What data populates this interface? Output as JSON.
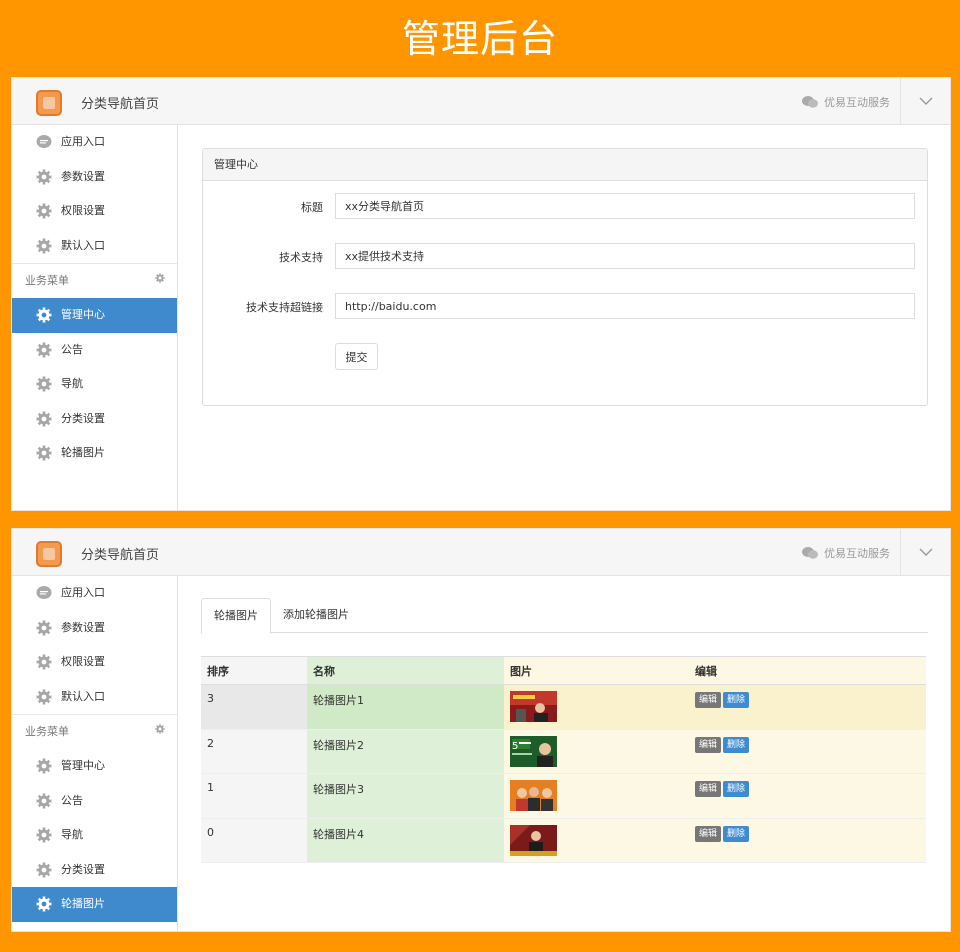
{
  "banner": {
    "title": "管理后台"
  },
  "app": {
    "title": "分类导航首页",
    "service": "优易互动服务"
  },
  "sidebar": {
    "top_items": [
      {
        "label": "应用入口",
        "icon": "chat-icon"
      },
      {
        "label": "参数设置",
        "icon": "gear-icon"
      },
      {
        "label": "权限设置",
        "icon": "gear-icon"
      },
      {
        "label": "默认入口",
        "icon": "gear-icon"
      }
    ],
    "section_label": "业务菜单",
    "biz_items": [
      {
        "label": "管理中心"
      },
      {
        "label": "公告"
      },
      {
        "label": "导航"
      },
      {
        "label": "分类设置"
      },
      {
        "label": "轮播图片"
      }
    ]
  },
  "panel1": {
    "active_item": "管理中心",
    "card_title": "管理中心",
    "fields": [
      {
        "label": "标题",
        "value": "xx分类导航首页"
      },
      {
        "label": "技术支持",
        "value": "xx提供技术支持"
      },
      {
        "label": "技术支持超链接",
        "value": "http://baidu.com"
      }
    ],
    "submit_label": "提交"
  },
  "panel2": {
    "active_item": "轮播图片",
    "tabs": [
      "轮播图片",
      "添加轮播图片"
    ],
    "columns": [
      "排序",
      "名称",
      "图片",
      "编辑"
    ],
    "rows": [
      {
        "order": "3",
        "name": "轮播图片1"
      },
      {
        "order": "2",
        "name": "轮播图片2"
      },
      {
        "order": "1",
        "name": "轮播图片3"
      },
      {
        "order": "0",
        "name": "轮播图片4"
      }
    ],
    "edit_label": "编辑",
    "delete_label": "删除"
  },
  "colors": {
    "accent": "#3e8acc",
    "brand_orange": "#ff9600",
    "edit_button": "#777777",
    "delete_button": "#3f8bd0"
  }
}
